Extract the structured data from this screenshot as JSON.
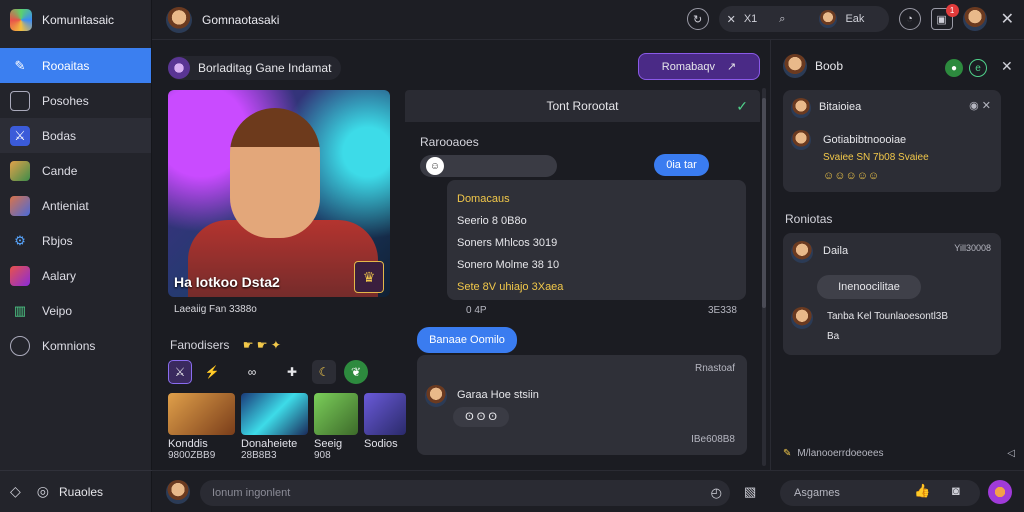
{
  "app": {
    "name": "Komunitasaic",
    "channel_title": "Gomnaotasaki"
  },
  "topbar": {
    "search_prefix": "X1",
    "search_user": "Eak",
    "notification_count": "1"
  },
  "sidebar": {
    "items": [
      {
        "label": "Rooaitas",
        "icon": "edit-icon"
      },
      {
        "label": "Posohes",
        "icon": "picture-icon"
      },
      {
        "label": "Bodas",
        "icon": "sword-icon"
      },
      {
        "label": "Cande",
        "icon": "game-icon"
      },
      {
        "label": "Antieniat",
        "icon": "character-icon"
      },
      {
        "label": "Rbjos",
        "icon": "controller-icon"
      },
      {
        "label": "Aalary",
        "icon": "flame-icon"
      },
      {
        "label": "Veipo",
        "icon": "book-icon"
      },
      {
        "label": "Komnions",
        "icon": "globe-icon"
      }
    ],
    "bottom_label": "Ruaoles"
  },
  "game": {
    "header": "Borladitag Gane Indamat",
    "hero_title": "Ha Iotkoo Dsta2",
    "hero_sub": "Laeaiig Fan 3388o",
    "favorites_label": "Fanodisers",
    "cards": [
      {
        "name": "Konddis",
        "price": "9800ZBB9"
      },
      {
        "name": "Donaheiete",
        "price": "28B8B3"
      },
      {
        "name": "Seeig",
        "price": "908"
      },
      {
        "name": "Sodios",
        "price": ""
      }
    ]
  },
  "action_button": "Romabaqv",
  "chat": {
    "title": "Tont Rorootat",
    "section_label": "Rarooaoes",
    "bubble_right": "0ia tar",
    "card_lines": [
      "Domacaus",
      "Seerio 8 0B8o",
      "Soners Mhlcos 3019",
      "Sonero Molme 38 10",
      "Sete 8V uhiajo 3Xaea"
    ],
    "card_left_meta": "0 4P",
    "card_right_meta": "3E338",
    "blue_pill": "Banaae Oomilo",
    "card2_meta": "Rnastoaf",
    "card2_user_line": "Garaa Hoe stsiin",
    "card2_reactions": "ʘ ʘ ʘ",
    "card2_time": "IBe608B8"
  },
  "right": {
    "user": "Boob",
    "card1_title": "Bitaioiea",
    "card1_line1": "Gotiabibtnoooiae",
    "card1_line2": "Svaiee SN 7b08 Svaiee",
    "section_label": "Roniotas",
    "card2_user": "Daila",
    "card2_time": "Yill30008",
    "card2_pill": "Inenoocilitae",
    "card2_line": "Tanba Kel Tounlaoesontl3B",
    "card2_reactions": "Ba",
    "footer": "M/lanooerrdoeoees"
  },
  "composer": {
    "placeholder": "Ionum ingonlent",
    "reply_placeholder": "Asgames"
  },
  "colors": {
    "accent": "#3b7ff0",
    "gold": "#f2c84a",
    "action": "#7a4ed8"
  }
}
